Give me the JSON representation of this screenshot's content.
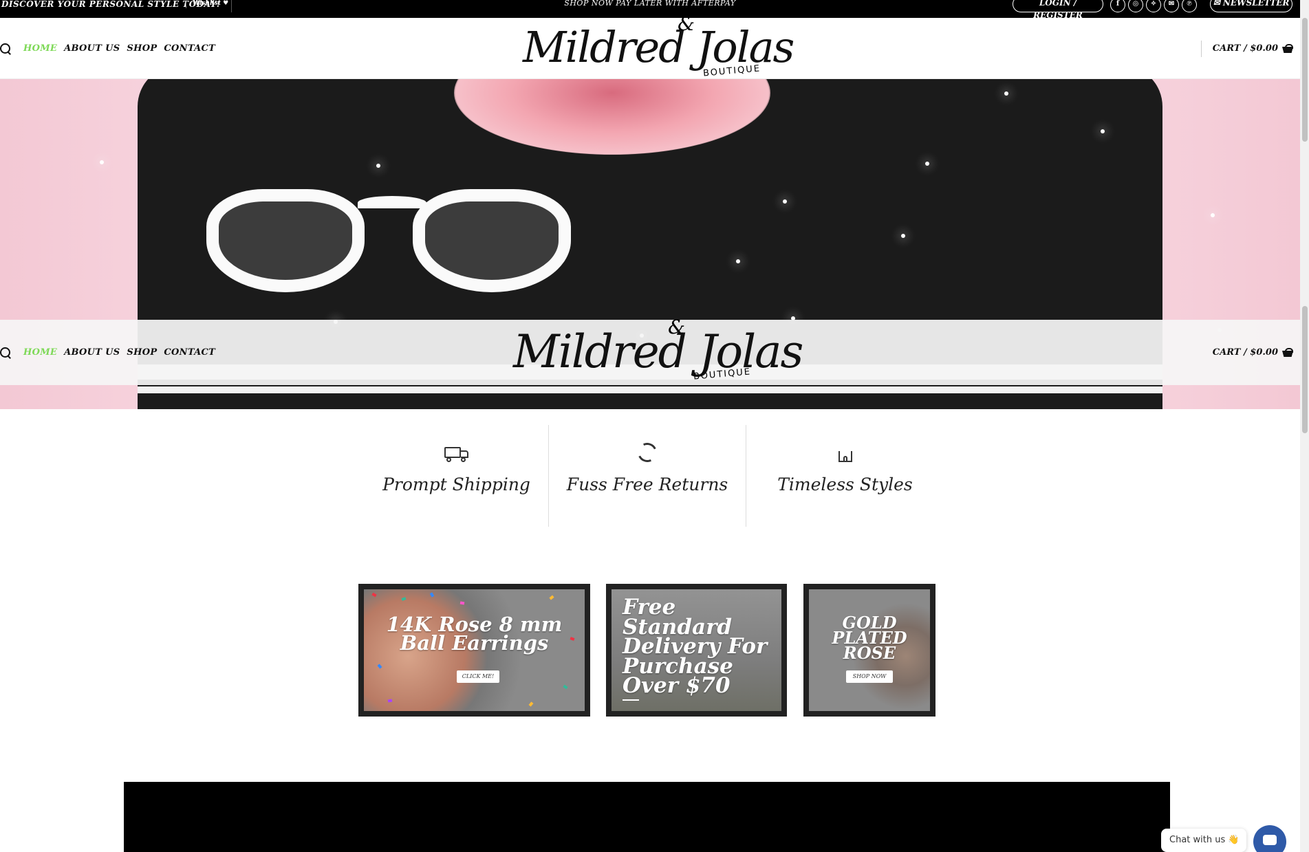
{
  "topbar": {
    "promo": "DISCOVER YOUR PERSONAL STYLE TODAY!",
    "wishlist": "Wishlist ♥",
    "center": "SHOP NOW PAY LATER WITH AFTERPAY",
    "login": "LOGIN / REGISTER",
    "social": [
      "f",
      "◎",
      "✧",
      "✉",
      "℗"
    ],
    "newsletter": "✉ NEWSLETTER"
  },
  "nav": {
    "items": [
      "HOME",
      "ABOUT US",
      "SHOP",
      "CONTACT"
    ]
  },
  "logo": {
    "script": "Mildred  Jolas",
    "amp": "&",
    "sub": "BOUTIQUE"
  },
  "cart": {
    "label": "CART / $0.00"
  },
  "features": [
    {
      "icon": "truck-icon",
      "label": "Prompt Shipping"
    },
    {
      "icon": "refresh-icon",
      "label": "Fuss Free Returns"
    },
    {
      "icon": "home-icon",
      "label": "Timeless Styles"
    }
  ],
  "tiles": [
    {
      "title": "14K Rose 8 mm Ball Earrings",
      "button": "CLICK ME!"
    },
    {
      "title": "Free Standard Delivery For Purchase Over $70"
    },
    {
      "title": "GOLD PLATED ROSE",
      "button": "SHOP NOW"
    }
  ],
  "chat": {
    "label": "Chat with us 👋"
  },
  "colors": {
    "accent": "#7ed957",
    "topbar": "#000000",
    "chat": "#2f5aa8"
  }
}
